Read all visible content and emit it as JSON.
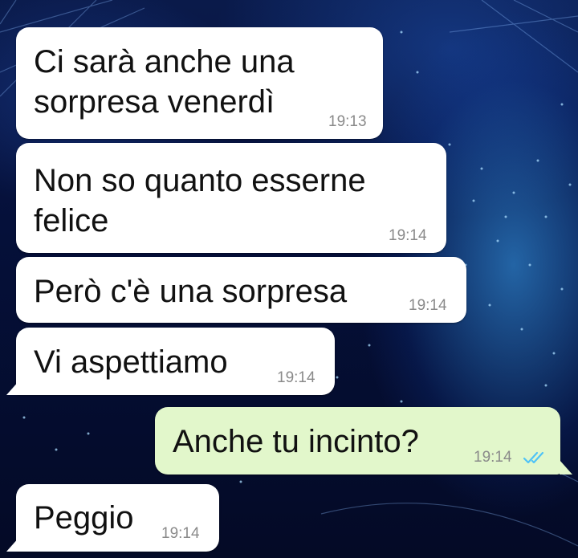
{
  "chat": {
    "accent_incoming": "#ffffff",
    "accent_outgoing": "#e2f7cb",
    "read_tick_color": "#4fc3f7",
    "messages": [
      {
        "direction": "incoming",
        "text": "Ci sarà anche una\nsorpresa venerdì",
        "time": "19:13"
      },
      {
        "direction": "incoming",
        "text": "Non so quanto esserne\nfelice",
        "time": "19:14"
      },
      {
        "direction": "incoming",
        "text": "Però c'è una sorpresa",
        "time": "19:14"
      },
      {
        "direction": "incoming",
        "text": "Vi aspettiamo",
        "time": "19:14"
      },
      {
        "direction": "outgoing",
        "text": "Anche tu incinto?",
        "time": "19:14",
        "status_icon": "double-check-read-icon"
      },
      {
        "direction": "incoming",
        "text": "Peggio",
        "time": "19:14"
      }
    ]
  }
}
